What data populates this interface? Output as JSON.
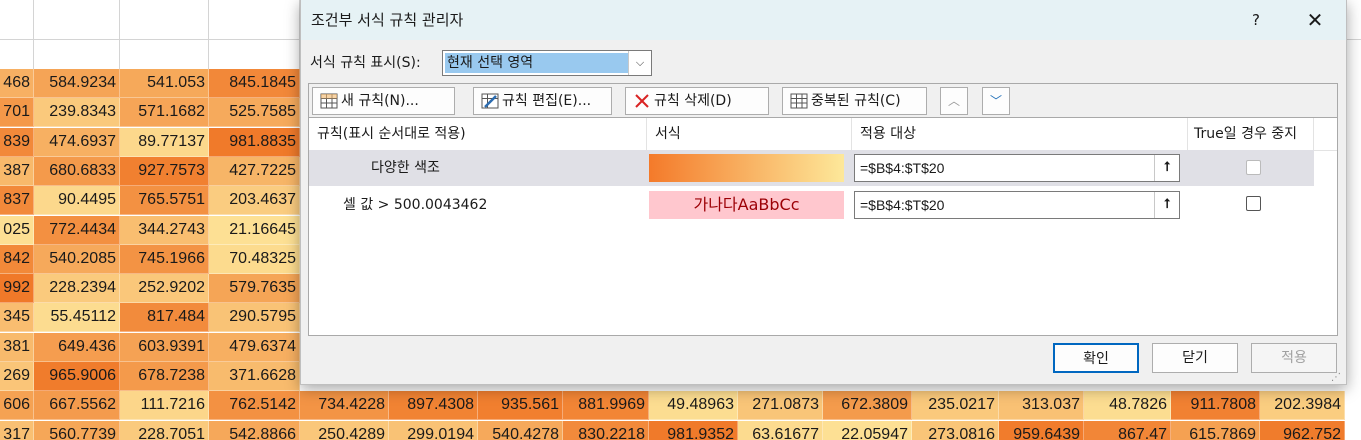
{
  "spreadsheet": {
    "rows": [
      [
        "468",
        "584.9234",
        "541.053",
        "845.1845"
      ],
      [
        "701",
        "239.8343",
        "571.1682",
        "525.7585"
      ],
      [
        "839",
        "474.6937",
        "89.77137",
        "981.8835"
      ],
      [
        "387",
        "680.6833",
        "927.7573",
        "427.7225"
      ],
      [
        "837",
        "90.4495",
        "765.5751",
        "203.4637"
      ],
      [
        "025",
        "772.4434",
        "344.2743",
        "21.16645"
      ],
      [
        "842",
        "540.2085",
        "745.1966",
        "70.48325"
      ],
      [
        "992",
        "228.2394",
        "252.9202",
        "579.7635"
      ],
      [
        "345",
        "55.45112",
        "817.484",
        "290.5795"
      ],
      [
        "381",
        "649.436",
        "603.9391",
        "479.6374"
      ],
      [
        "269",
        "965.9006",
        "678.7238",
        "371.6628"
      ],
      [
        "606",
        "667.5562",
        "111.7216",
        "762.5142",
        "734.4228",
        "897.4308",
        "935.561",
        "881.9969",
        "49.48963",
        "271.0873",
        "672.3809",
        "235.0217",
        "313.037",
        "48.7826",
        "911.7808",
        "202.3984"
      ],
      [
        "317",
        "560.7739",
        "228.7051",
        "542.8866",
        "250.4289",
        "299.0194",
        "540.4278",
        "830.2218",
        "981.9352",
        "63.61677",
        "22.05947",
        "273.0816",
        "959.6439",
        "867.47",
        "615.7869",
        "962.752"
      ]
    ]
  },
  "dialog": {
    "title": "조건부 서식 규칙 관리자",
    "help": "?",
    "close": "✕",
    "show_rules_label": "서식 규칙 표시(S):",
    "show_rules_value": "현재 선택 영역",
    "toolbar": {
      "new_rule": "새 규칙(N)...",
      "edit_rule": "규칙 편집(E)...",
      "delete_rule": "규칙 삭제(D)",
      "duplicate_rule": "중복된 규칙(C)",
      "move_up": "︿",
      "move_down": "﹀"
    },
    "columns": {
      "rule": "규칙(표시 순서대로 적용)",
      "format": "서식",
      "applies_to": "적용 대상",
      "stop_if_true": "True일 경우 중지"
    },
    "rules": [
      {
        "name": "다양한 색조",
        "format_preview": "",
        "applies_to": "=$B$4:$T$20",
        "stop_if_true": false,
        "selected": true
      },
      {
        "name": "셀 값 > 500.0043462",
        "format_preview": "가나다AaBbCc",
        "applies_to": "=$B$4:$T$20",
        "stop_if_true": false,
        "selected": false
      }
    ],
    "collapse_icon": "⭡",
    "ok": "확인",
    "close_button": "닫기",
    "apply": "적용"
  },
  "colors": {
    "selected_row": "#e0e0e6",
    "scale_start": "#f47a2a",
    "scale_end": "#fde89a",
    "format_fill": "#ffc7ce",
    "format_text": "#9c0006"
  }
}
